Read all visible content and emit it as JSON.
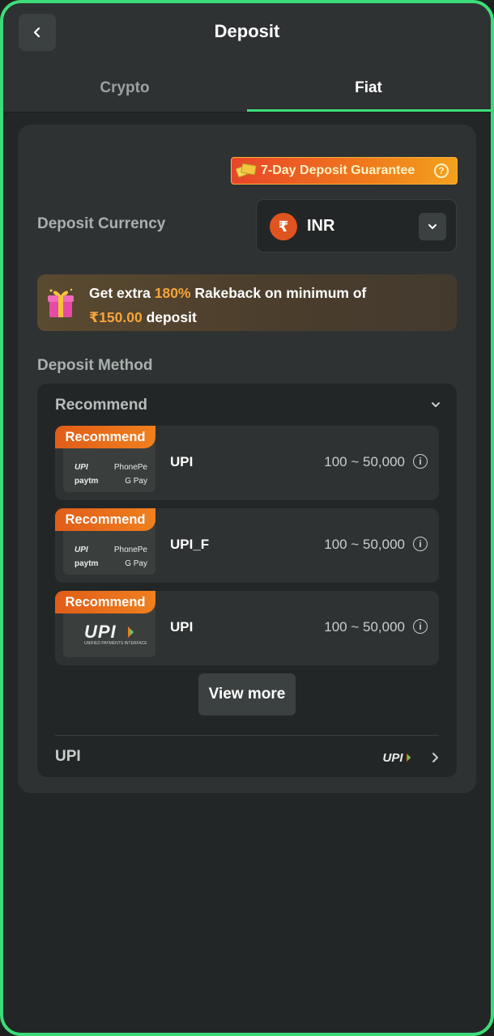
{
  "header": {
    "title": "Deposit"
  },
  "tabs": [
    {
      "label": "Crypto"
    },
    {
      "label": "Fiat"
    }
  ],
  "guarantee": {
    "label": "7-Day Deposit Guarantee"
  },
  "currency": {
    "label": "Deposit Currency",
    "code": "INR",
    "symbol": "₹"
  },
  "promo": {
    "prefix": "Get extra ",
    "percent": "180%",
    "middle": " Rakeback on minimum of",
    "amount": "₹150.00",
    "suffix": " deposit"
  },
  "method": {
    "label": "Deposit Method",
    "group_title": "Recommend",
    "items": [
      {
        "badge": "Recommend",
        "name": "UPI",
        "range": "100 ~ 50,000",
        "logo": "multi"
      },
      {
        "badge": "Recommend",
        "name": "UPI_F",
        "range": "100 ~ 50,000",
        "logo": "multi"
      },
      {
        "badge": "Recommend",
        "name": "UPI",
        "range": "100 ~ 50,000",
        "logo": "upi"
      }
    ],
    "view_more": "View more",
    "footer_label": "UPI"
  },
  "logo_text": {
    "upi": "UPI",
    "phonepe": "PhonePe",
    "paytm": "paytm",
    "gpay": "G Pay",
    "upi_sub": "UNIFIED PAYMENTS INTERFACE"
  },
  "colors": {
    "accent": "#3ddc7a",
    "orange": "#f07a1c",
    "highlight": "#f7a43a"
  }
}
